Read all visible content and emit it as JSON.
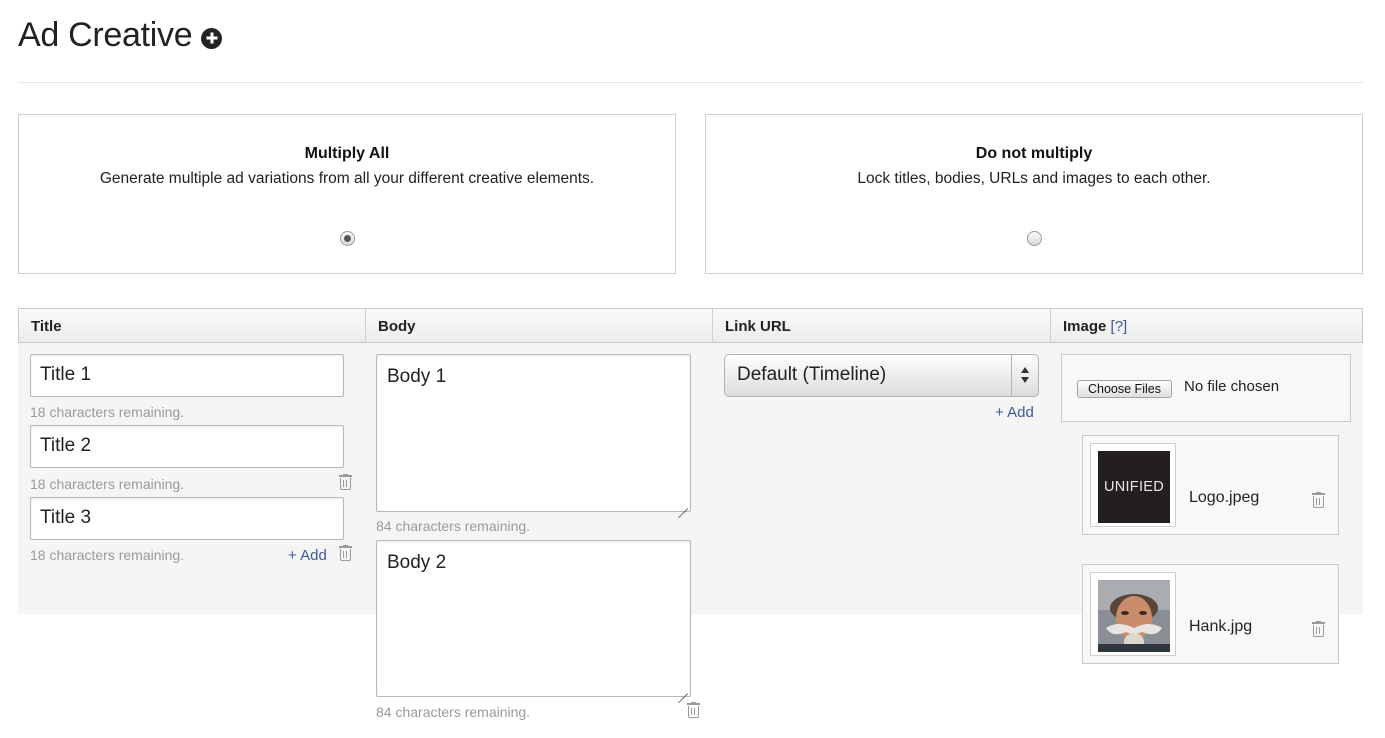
{
  "header": {
    "title": "Ad Creative",
    "add_icon": "plus-circle-icon"
  },
  "multiply_options": [
    {
      "title": "Multiply All",
      "description": "Generate multiple ad variations from all your different creative elements.",
      "selected": true
    },
    {
      "title": "Do not multiply",
      "description": "Lock titles, bodies, URLs and images to each other.",
      "selected": false
    }
  ],
  "columns": {
    "title": "Title",
    "body": "Body",
    "link_url": "Link URL",
    "image": "Image",
    "image_help": "[?]"
  },
  "titles": [
    {
      "value": "Title 1",
      "remaining": "18 characters remaining."
    },
    {
      "value": "Title 2",
      "remaining": "18 characters remaining."
    },
    {
      "value": "Title 3",
      "remaining": "18 characters remaining."
    }
  ],
  "bodies": [
    {
      "value": "Body 1",
      "remaining": "84 characters remaining."
    },
    {
      "value": "Body 2",
      "remaining": "84 characters remaining."
    }
  ],
  "link_url": {
    "selected": "Default (Timeline)"
  },
  "add_label": "+ Add",
  "file_input": {
    "button_label": "Choose Files",
    "status": "No file chosen"
  },
  "images": [
    {
      "name": "Logo.jpeg",
      "thumb_text": "UNIFIED"
    },
    {
      "name": "Hank.jpg"
    }
  ],
  "icons": {
    "delete": "trash-icon"
  },
  "colors": {
    "link": "#3b5998",
    "muted_text": "#9a9a9a",
    "border": "#c9c9c9"
  }
}
